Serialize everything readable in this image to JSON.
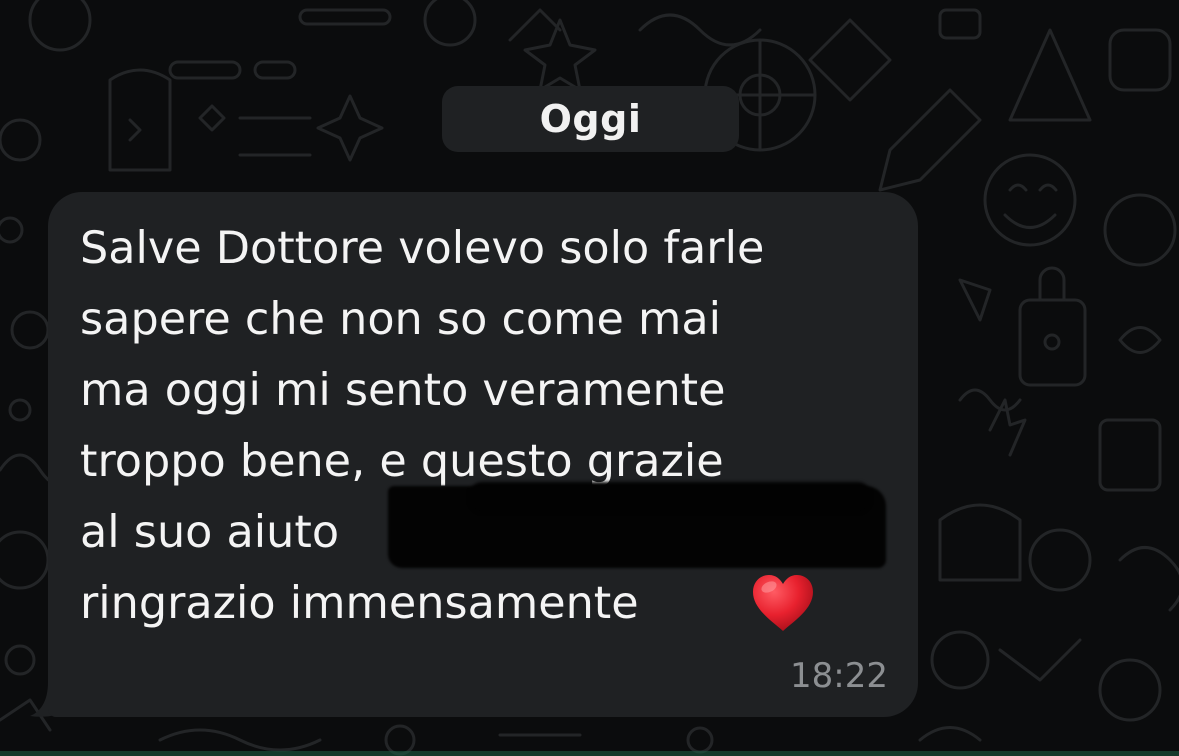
{
  "chat": {
    "date_separator": "Oggi",
    "message": {
      "lines": [
        "Salve Dottore volevo solo farle",
        "sapere che non so come mai",
        "ma oggi mi sento veramente",
        "troppo bene, e questo grazie",
        "al suo aiuto",
        "ringrazio immensamente"
      ],
      "emoji": "heart-icon",
      "time": "18:22",
      "redacted": true
    }
  },
  "colors": {
    "background": "#0b0c0d",
    "bubble": "#1f2123",
    "text": "#f4f4f4",
    "timestamp": "#8c8f92",
    "heart": "#e8212e"
  }
}
